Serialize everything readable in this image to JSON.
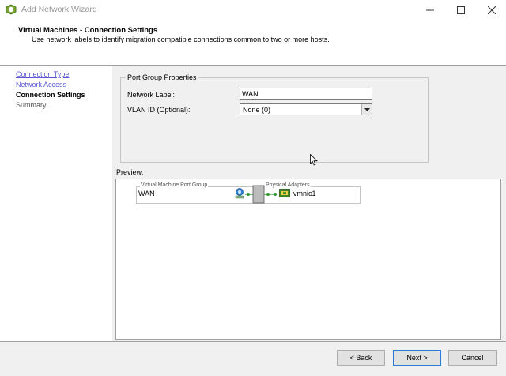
{
  "window": {
    "title": "Add Network Wizard",
    "minimize_icon": "minimize-icon",
    "maximize_icon": "maximize-icon",
    "close_icon": "close-icon"
  },
  "header": {
    "title": "Virtual Machines - Connection Settings",
    "subtitle": "Use network labels to identify migration compatible connections common to two or more hosts."
  },
  "nav": {
    "items": [
      {
        "label": "Connection Type",
        "state": "link"
      },
      {
        "label": "Network Access",
        "state": "link"
      },
      {
        "label": "Connection Settings",
        "state": "current"
      },
      {
        "label": "Summary",
        "state": "future"
      }
    ]
  },
  "port_group": {
    "legend": "Port Group Properties",
    "network_label_label": "Network Label:",
    "network_label_value": "WAN",
    "vlan_label": "VLAN ID (Optional):",
    "vlan_value": "None (0)"
  },
  "preview": {
    "label": "Preview:",
    "vm_port_group_legend": "Virtual Machine Port Group",
    "physical_adapters_legend": "Physical Adapters",
    "port_group_name": "WAN",
    "adapter_name": "vmnic1"
  },
  "buttons": {
    "back": "< Back",
    "next": "Next >",
    "cancel": "Cancel"
  },
  "colors": {
    "link": "#5b5bd6",
    "focus_border": "#2c7ad6",
    "nic_green": "#3c8a1e",
    "connector_green": "#2e9a2e"
  }
}
